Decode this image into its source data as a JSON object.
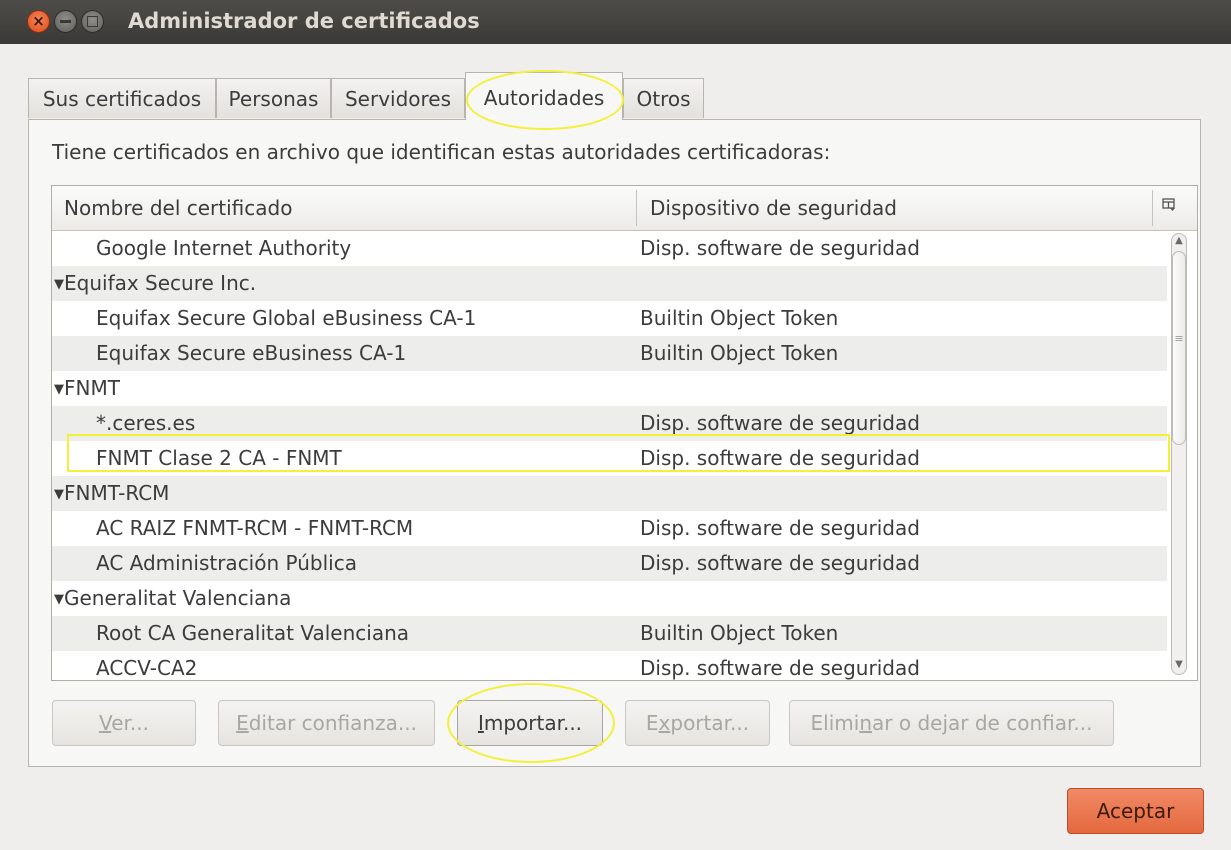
{
  "window": {
    "title": "Administrador de certificados"
  },
  "tabs": [
    {
      "label": "Sus certificados",
      "active": false
    },
    {
      "label": "Personas",
      "active": false
    },
    {
      "label": "Servidores",
      "active": false
    },
    {
      "label": "Autoridades",
      "active": true
    },
    {
      "label": "Otros",
      "active": false
    }
  ],
  "intro_text": "Tiene certificados en archivo que identifican estas autoridades certificadoras:",
  "table": {
    "columns": [
      "Nombre del certificado",
      "Dispositivo de seguridad"
    ],
    "column_picker_icon": "column-picker-icon",
    "rows": [
      {
        "type": "child",
        "name": "Google Internet Authority",
        "device": "Disp. software de seguridad"
      },
      {
        "type": "group",
        "name": "Equifax Secure Inc.",
        "device": ""
      },
      {
        "type": "child",
        "name": "Equifax Secure Global eBusiness CA-1",
        "device": "Builtin Object Token"
      },
      {
        "type": "child",
        "name": "Equifax Secure eBusiness CA-1",
        "device": "Builtin Object Token"
      },
      {
        "type": "group",
        "name": "FNMT",
        "device": ""
      },
      {
        "type": "child",
        "name": "*.ceres.es",
        "device": "Disp. software de seguridad"
      },
      {
        "type": "child",
        "name": "FNMT Clase 2 CA - FNMT",
        "device": "Disp. software de seguridad"
      },
      {
        "type": "group",
        "name": "FNMT-RCM",
        "device": ""
      },
      {
        "type": "child",
        "name": "AC RAIZ FNMT-RCM - FNMT-RCM",
        "device": "Disp. software de seguridad"
      },
      {
        "type": "child",
        "name": "AC Administración Pública",
        "device": "Disp. software de seguridad"
      },
      {
        "type": "group",
        "name": "Generalitat Valenciana",
        "device": ""
      },
      {
        "type": "child",
        "name": "Root CA Generalitat Valenciana",
        "device": "Builtin Object Token"
      },
      {
        "type": "child",
        "name": "ACCV-CA2",
        "device": "Disp. software de seguridad"
      }
    ]
  },
  "buttons": {
    "ver": {
      "pre": "",
      "mn": "V",
      "post": "er..."
    },
    "editar": {
      "pre": "",
      "mn": "E",
      "post": "ditar confianza..."
    },
    "importar": {
      "pre": "",
      "mn": "I",
      "post": "mportar..."
    },
    "exportar": {
      "pre": "E",
      "mn": "x",
      "post": "portar..."
    },
    "eliminar": {
      "pre": "Elimi",
      "mn": "n",
      "post": "ar o dejar de confiar..."
    },
    "aceptar": "Aceptar"
  },
  "colors": {
    "highlight": "#f3f03a",
    "accent": "#e4683e"
  }
}
